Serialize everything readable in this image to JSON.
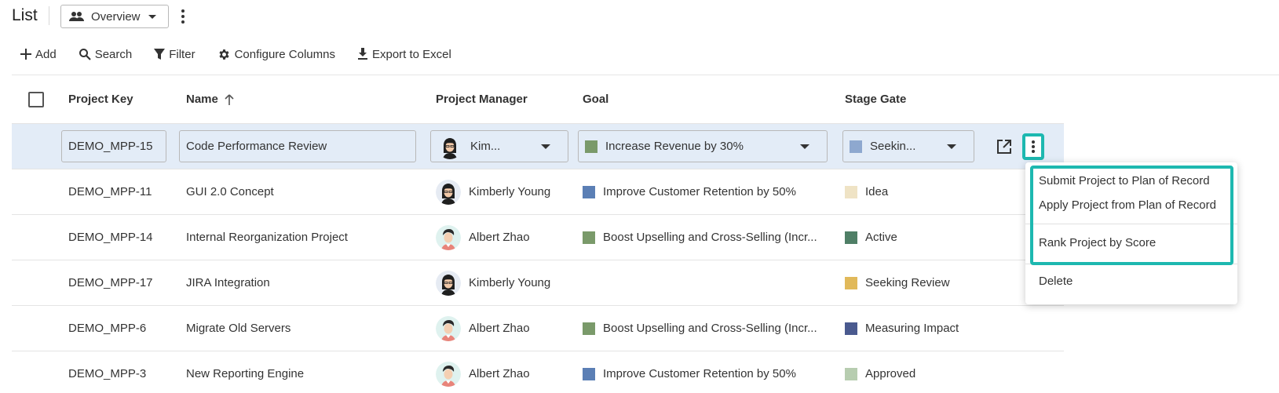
{
  "header": {
    "title": "List",
    "view_label": "Overview"
  },
  "toolbar": {
    "add": "Add",
    "search": "Search",
    "filter": "Filter",
    "configure_columns": "Configure Columns",
    "export": "Export to Excel"
  },
  "table": {
    "columns": {
      "key": "Project Key",
      "name": "Name",
      "pm": "Project Manager",
      "goal": "Goal",
      "stage": "Stage Gate"
    },
    "editing_row": {
      "key": "DEMO_MPP-15",
      "name": "Code Performance Review",
      "pm": "Kim...",
      "goal": "Increase Revenue by 30%",
      "goal_color": "#7a9a6a",
      "stage": "Seekin...",
      "stage_color": "#8ea8cf"
    },
    "rows": [
      {
        "key": "DEMO_MPP-11",
        "name": "GUI 2.0 Concept",
        "pm": "Kimberly Young",
        "pm_avatar": "female",
        "goal": "Improve Customer Retention by 50%",
        "goal_color": "#5b7fb5",
        "stage": "Idea",
        "stage_color": "#efe3c5"
      },
      {
        "key": "DEMO_MPP-14",
        "name": "Internal Reorganization Project",
        "pm": "Albert Zhao",
        "pm_avatar": "male",
        "goal": "Boost Upselling and Cross-Selling (Incr...",
        "goal_color": "#7a9a6a",
        "stage": "Active",
        "stage_color": "#4f7f66"
      },
      {
        "key": "DEMO_MPP-17",
        "name": "JIRA Integration",
        "pm": "Kimberly Young",
        "pm_avatar": "female",
        "goal": "",
        "goal_color": "",
        "stage": "Seeking Review",
        "stage_color": "#e1b95a"
      },
      {
        "key": "DEMO_MPP-6",
        "name": "Migrate Old Servers",
        "pm": "Albert Zhao",
        "pm_avatar": "male",
        "goal": "Boost Upselling and Cross-Selling (Incr...",
        "goal_color": "#7a9a6a",
        "stage": "Measuring Impact",
        "stage_color": "#4a5a8f"
      },
      {
        "key": "DEMO_MPP-3",
        "name": "New Reporting Engine",
        "pm": "Albert Zhao",
        "pm_avatar": "male",
        "goal": "Improve Customer Retention by 50%",
        "goal_color": "#5b7fb5",
        "stage": "Approved",
        "stage_color": "#b7cdb0"
      }
    ]
  },
  "menu": {
    "items": [
      "Submit Project to Plan of Record",
      "Apply Project from Plan of Record",
      "Rank Project by Score",
      "Delete"
    ]
  },
  "colors": {
    "highlight": "#1db8b0",
    "editing_row_bg": "#e3ecf7"
  }
}
